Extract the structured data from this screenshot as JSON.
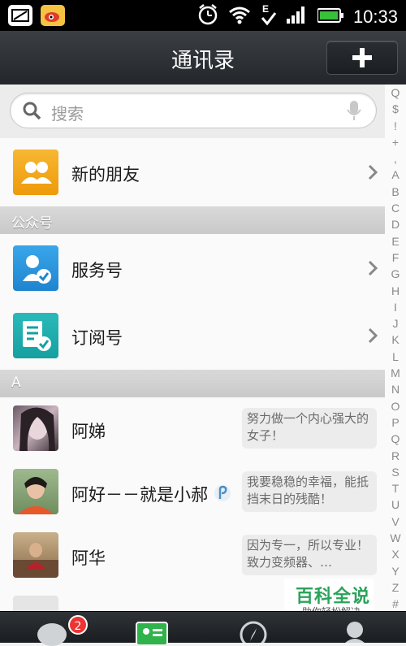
{
  "status_bar": {
    "time": "10:33"
  },
  "header": {
    "title": "通讯录",
    "add_label": "+"
  },
  "search": {
    "placeholder": "搜索"
  },
  "new_friends": {
    "label": "新的朋友"
  },
  "sections": {
    "public": "公众号",
    "a": "A"
  },
  "public_items": [
    {
      "label": "服务号"
    },
    {
      "label": "订阅号"
    }
  ],
  "contacts": [
    {
      "name": "阿娣",
      "signature": "努力做一个内心强大的女子！"
    },
    {
      "name": "阿好－－就是小郝",
      "signature": "我要稳稳的幸福，能抵挡末日的残酷！"
    },
    {
      "name": "阿华",
      "signature": "因为专一，所以专业！致力变频器、…"
    }
  ],
  "index_letters": [
    "Q",
    "$",
    "!",
    "+",
    ",",
    "A",
    "B",
    "C",
    "D",
    "E",
    "F",
    "G",
    "H",
    "I",
    "J",
    "K",
    "L",
    "M",
    "N",
    "O",
    "P",
    "Q",
    "R",
    "S",
    "T",
    "U",
    "V",
    "W",
    "X",
    "Y",
    "Z",
    "#"
  ],
  "tabs": {
    "chats_badge": "2"
  },
  "watermark": {
    "main": "百科全说",
    "sub": "助你轻松解决"
  },
  "colors": {
    "header": "#2b2f33",
    "accent_orange": "#f3a416",
    "accent_blue": "#2a8fd6",
    "accent_teal": "#1aa8a8",
    "badge": "#e33333",
    "watermark_green": "#2aa35a"
  }
}
